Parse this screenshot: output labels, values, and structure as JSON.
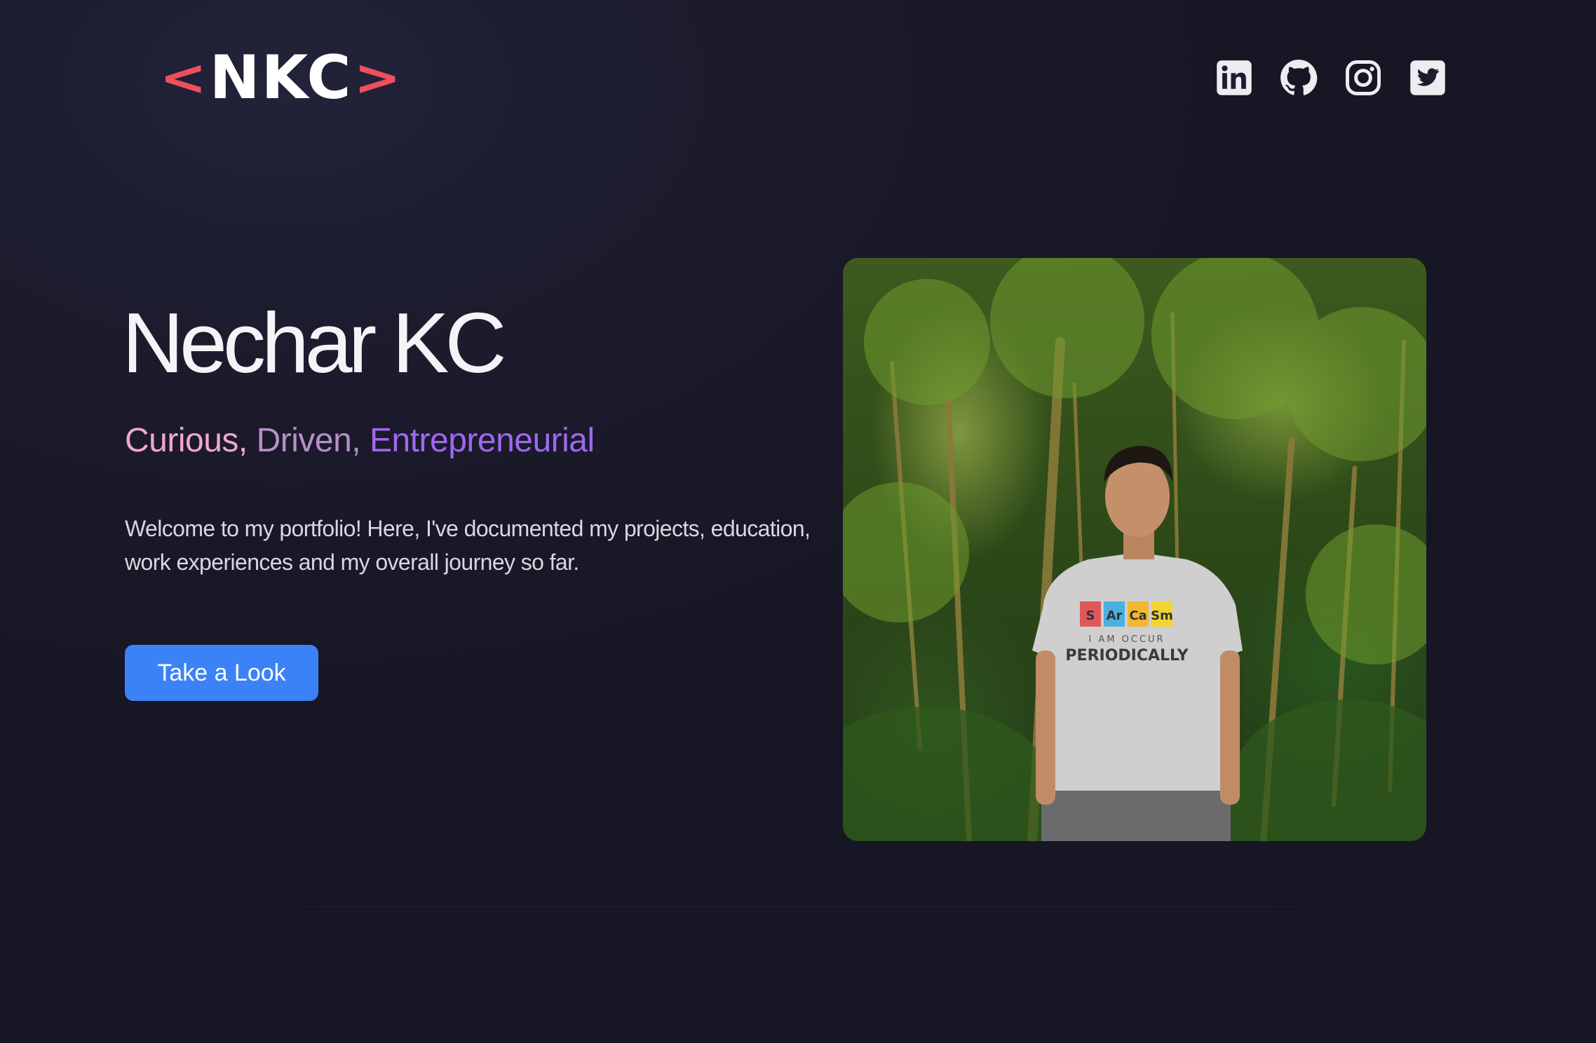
{
  "header": {
    "logo": {
      "left_bracket": "<",
      "text": "NKC",
      "right_bracket": ">"
    },
    "socials": [
      {
        "name": "LinkedIn",
        "icon": "linkedin-icon"
      },
      {
        "name": "GitHub",
        "icon": "github-icon"
      },
      {
        "name": "Instagram",
        "icon": "instagram-icon"
      },
      {
        "name": "Twitter",
        "icon": "twitter-icon"
      }
    ]
  },
  "hero": {
    "name": "Nechar KC",
    "tagline": {
      "w1": "Curious,",
      "w2": "Driven,",
      "w3": "Entrepreneurial"
    },
    "intro": "Welcome to my portfolio! Here, I've documented my projects, education, work experiences and my overall journey so far.",
    "cta_label": "Take a Look",
    "photo": {
      "shirt_text": {
        "el1": "S",
        "el2": "Ar",
        "el3": "Ca",
        "el4": "Sm",
        "sub": "I AM OCCUR",
        "main": "PERIODICALLY"
      }
    }
  },
  "colors": {
    "accent": "#3b82f6",
    "logo_bracket": "#ef4f5a",
    "tagline_1": "#f0a6cf",
    "tagline_2": "#b78fc9",
    "tagline_3": "#a067f0",
    "background": "#1b1b2c"
  }
}
